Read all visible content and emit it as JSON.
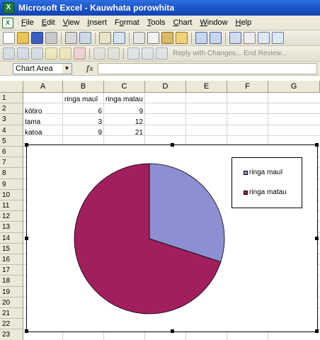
{
  "window": {
    "title": "Microsoft Excel - Kauwhata porowhita",
    "app_icon": "excel-icon"
  },
  "menubar": [
    {
      "label": "File",
      "u": "F",
      "rest": "ile"
    },
    {
      "label": "Edit",
      "u": "E",
      "rest": "dit"
    },
    {
      "label": "View",
      "u": "V",
      "rest": "iew"
    },
    {
      "label": "Insert",
      "u": "I",
      "rest": "nsert"
    },
    {
      "label": "Format",
      "u": "o",
      "pre": "F",
      "rest": "rmat"
    },
    {
      "label": "Tools",
      "u": "T",
      "rest": "ools"
    },
    {
      "label": "Chart",
      "u": "C",
      "rest": "hart"
    },
    {
      "label": "Window",
      "u": "W",
      "rest": "indow"
    },
    {
      "label": "Help",
      "u": "H",
      "rest": "elp"
    }
  ],
  "toolbar2": {
    "reply_text": "Reply with Changes...  End Review..."
  },
  "formula_bar": {
    "name_box": "Chart Area",
    "fx": "fx",
    "value": ""
  },
  "columns": [
    "A",
    "B",
    "C",
    "D",
    "E",
    "F",
    "G"
  ],
  "rows": [
    "1",
    "2",
    "3",
    "4",
    "5",
    "6",
    "7",
    "8",
    "9",
    "10",
    "11",
    "12",
    "13",
    "14",
    "15",
    "16",
    "17",
    "18",
    "19",
    "20",
    "21",
    "22",
    "23"
  ],
  "table": {
    "headers": [
      "",
      "ringa mauī",
      "ringa matau"
    ],
    "rows": [
      [
        "kōtiro",
        "6",
        "9"
      ],
      [
        "tama",
        "3",
        "12"
      ],
      [
        "katoa",
        "9",
        "21"
      ]
    ]
  },
  "chart_data": {
    "type": "pie",
    "categories": [
      "ringa mauī",
      "ringa matau"
    ],
    "values": [
      9,
      21
    ],
    "colors": [
      "#8c8fd1",
      "#a11f5c"
    ],
    "title": "",
    "legend": "right"
  },
  "colors": {
    "slice1": "#8c8fd1",
    "slice2": "#a11f5c",
    "title_bar": "#1a4fc4"
  }
}
